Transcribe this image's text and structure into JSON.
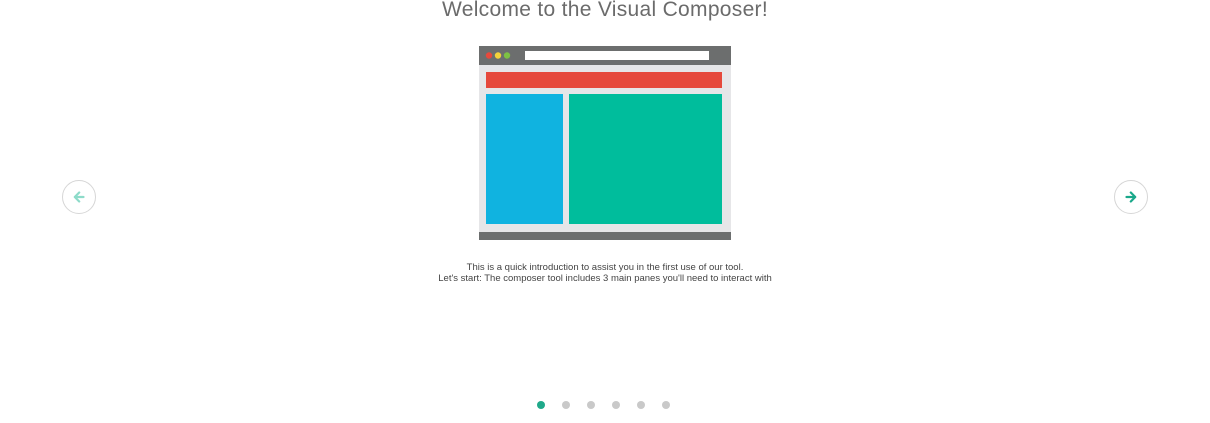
{
  "intro": {
    "title": "Welcome to the Visual Composer!",
    "description_line1": "This is a quick introduction to assist you in the first use of our tool.",
    "description_line2": "Let's start: The composer tool includes 3 main panes you'll need to interact with"
  },
  "navigation": {
    "prev_icon": "arrow-left-icon",
    "next_icon": "arrow-right-icon",
    "prev_color": "#8ddbc9",
    "next_color": "#1aa88a"
  },
  "pagination": {
    "total": 6,
    "active_index": 0,
    "active_color": "#20a98a",
    "inactive_color": "#c9c9c9"
  },
  "illustration": {
    "frame_color": "#6c6e6e",
    "window_bg": "#e6e6e8",
    "header_bar_color": "#e6493c",
    "left_pane_color": "#10b3e0",
    "right_pane_color": "#00bd9c",
    "window_dots": [
      "#e6493c",
      "#f3d23a",
      "#7dc143"
    ]
  }
}
